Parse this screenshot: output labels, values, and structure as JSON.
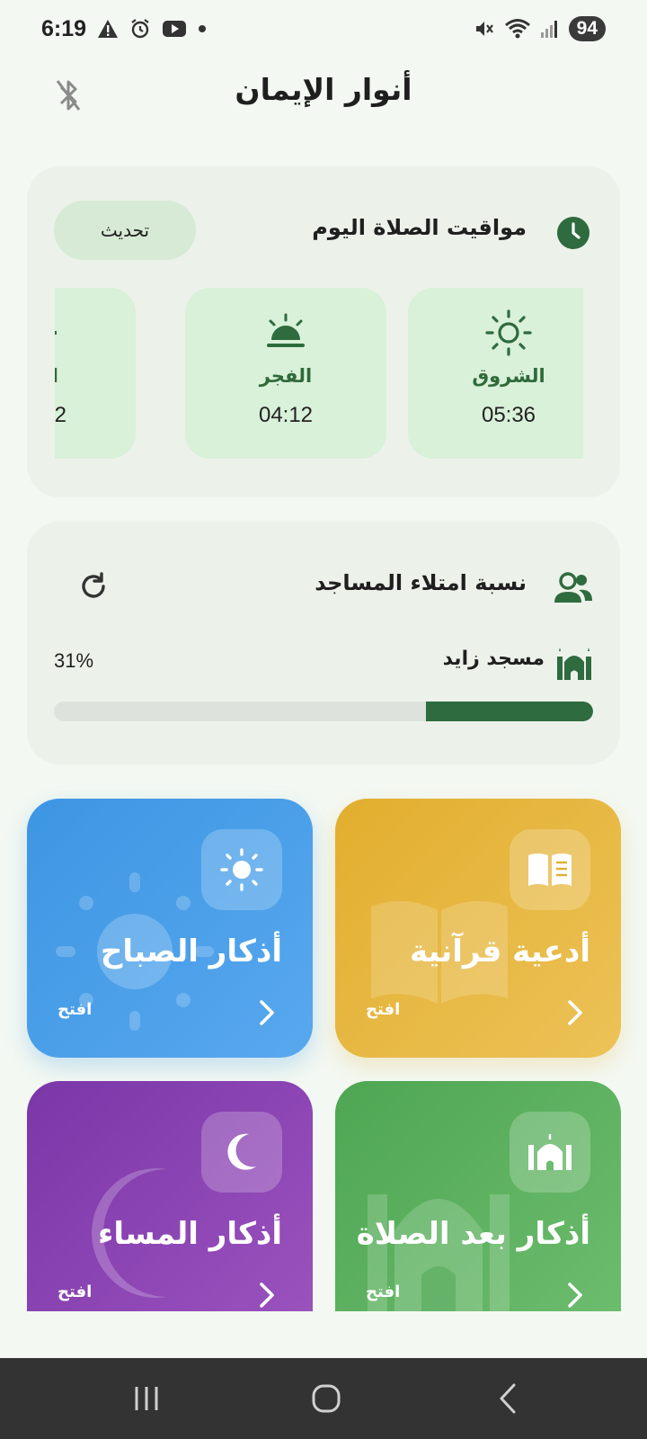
{
  "status_bar": {
    "time": "6:19",
    "battery": "94",
    "left_icons": [
      "alert-icon",
      "alarm-icon",
      "youtube-icon",
      "dot-icon"
    ],
    "right_icons": [
      "mute-icon",
      "wifi-icon",
      "signal-icon"
    ]
  },
  "header": {
    "title": "أنوار الإيمان",
    "bluetooth_icon": "bluetooth-disabled-icon"
  },
  "prayer_card": {
    "title": "مواقيت الصلاة اليوم",
    "refresh_label": "تحديث",
    "tiles": [
      {
        "name": "الشروق",
        "time": "05:36",
        "icon": "sun-icon"
      },
      {
        "name": "الفجر",
        "time": "04:12",
        "icon": "sunrise-icon"
      },
      {
        "name": "ا",
        "time": "2",
        "icon": "partial-icon"
      }
    ]
  },
  "mosque_card": {
    "title": "نسبة امتلاء المساجد",
    "mosque_name": "مسجد زايد",
    "percent_text": "31%",
    "fill_fraction": 0.31,
    "colors": {
      "fill": "#2e6b3e",
      "track": "#dde3dc"
    }
  },
  "features": {
    "morning": {
      "title": "أذكار الصباح",
      "open_label": "افتح",
      "icon": "sun-icon",
      "color": "#3d96e3"
    },
    "quran": {
      "title": "أدعية قرآنية",
      "open_label": "افتح",
      "icon": "book-icon",
      "color": "#e2ae2e"
    },
    "evening": {
      "title": "أذكار المساء",
      "open_label": "افتح",
      "icon": "moon-icon",
      "color": "#7b36a8"
    },
    "after_prayer": {
      "title": "أذكار بعد الصلاة",
      "open_label": "افتح",
      "icon": "mosque-icon",
      "color": "#4ea653"
    }
  },
  "nav": {
    "recent": "recent-apps-icon",
    "home": "home-icon",
    "back": "back-icon"
  }
}
